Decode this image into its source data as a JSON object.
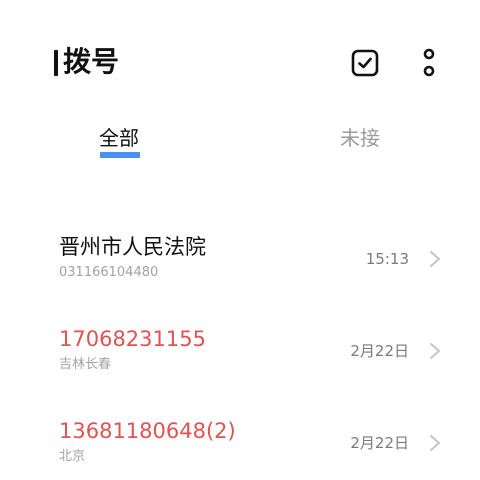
{
  "header": {
    "title": "拨号",
    "select_icon": "checkbox-square-icon",
    "more_icon": "more-vertical-icon"
  },
  "tabs": [
    {
      "label": "全部",
      "active": true
    },
    {
      "label": "未接",
      "active": false
    }
  ],
  "calls": [
    {
      "name": "晋州市人民法院",
      "detail": "031166104480",
      "time": "15:13",
      "missed": false
    },
    {
      "name": "17068231155",
      "detail": "吉林长春",
      "time": "2月22日",
      "missed": true
    },
    {
      "name": "13681180648(2)",
      "detail": "北京",
      "time": "2月22日",
      "missed": true
    }
  ],
  "colors": {
    "accent": "#4a90f0",
    "missed": "#e05353",
    "text": "#111111",
    "secondary": "#a3a3a3"
  }
}
